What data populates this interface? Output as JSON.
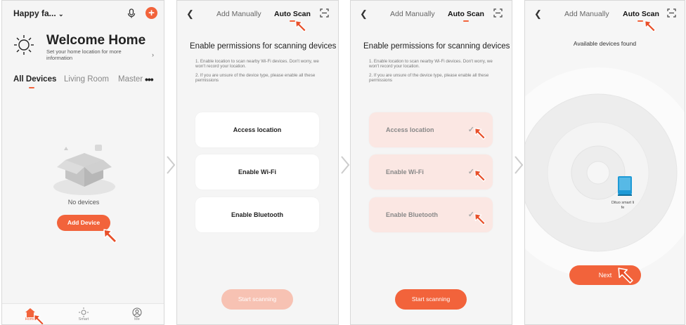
{
  "colors": {
    "accent": "#f2633b",
    "accent_light": "#f7c2b3",
    "check_bg": "#fbe7e3"
  },
  "home": {
    "name": "Happy fa...",
    "welcome_title": "Welcome Home",
    "welcome_sub": "Set your home location for more information",
    "tabs": [
      "All Devices",
      "Living Room",
      "Master"
    ],
    "more": "•••",
    "empty_text": "No devices",
    "add_device": "Add Device",
    "tabbar": [
      "Home",
      "Smart",
      "Me"
    ]
  },
  "scan": {
    "tab_manual": "Add Manually",
    "tab_auto": "Auto Scan",
    "perm_title": "Enable permissions for scanning devices",
    "note1": "1. Enable location to scan nearby Wi-Fi devices. Don't worry, we won't record your location.",
    "note2": "2. If you are unsure of the device type, please enable all these permissions",
    "btn_location": "Access location",
    "btn_wifi": "Enable Wi-Fi",
    "btn_bluetooth": "Enable Bluetooth",
    "start": "Start scanning",
    "start_state_disabled": true
  },
  "result": {
    "title": "Available devices found",
    "device_name": "Dituo smart li fe",
    "next": "Next"
  }
}
